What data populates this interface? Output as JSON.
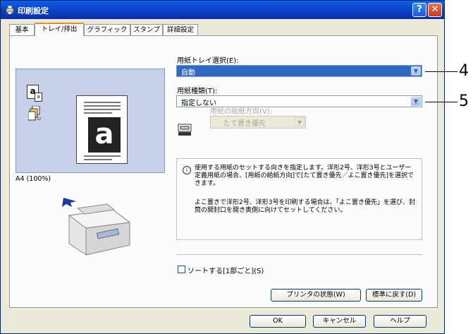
{
  "window": {
    "title": "印刷設定"
  },
  "tabs": [
    {
      "label": "基本"
    },
    {
      "label": "トレイ/排出"
    },
    {
      "label": "グラフィックス"
    },
    {
      "label": "スタンプ"
    },
    {
      "label": "詳細設定"
    }
  ],
  "preview": {
    "paper_label": "A4 (100%)"
  },
  "paper_tray": {
    "label": "用紙トレイ選択(E):",
    "value": "自動"
  },
  "paper_type": {
    "label": "用紙種類(T):",
    "value": "指定しない"
  },
  "feed_direction": {
    "label": "用紙の給紙方向(V):",
    "value": "たて置き優先"
  },
  "info": {
    "paragraph1": "使用する用紙のセットする向きを指定します。洋形2号、洋形3号とユーザー定義用紙の場合、[用紙の給紙方向]で[たて置き優先／よこ置き優先]を選択できます。",
    "paragraph2": "よこ置きで洋形2号、洋形3号を印刷する場合は、「よこ置き優先」を選び、封筒の開封口を開き奥側に向けてセットしてください。"
  },
  "sort_checkbox": {
    "label": "ソートする[1部ごと](S)",
    "checked": false
  },
  "buttons": {
    "printer_status": "プリンタの状態(W)",
    "restore_defaults": "標準に戻す(D)",
    "ok": "OK",
    "cancel": "キャンセル",
    "help": "ヘルプ"
  },
  "callouts": {
    "c4": "4",
    "c5": "5"
  },
  "colors": {
    "accent": "#316ac5",
    "titlebar": "#0a3fc4",
    "tab_highlight": "#e68b2c"
  }
}
